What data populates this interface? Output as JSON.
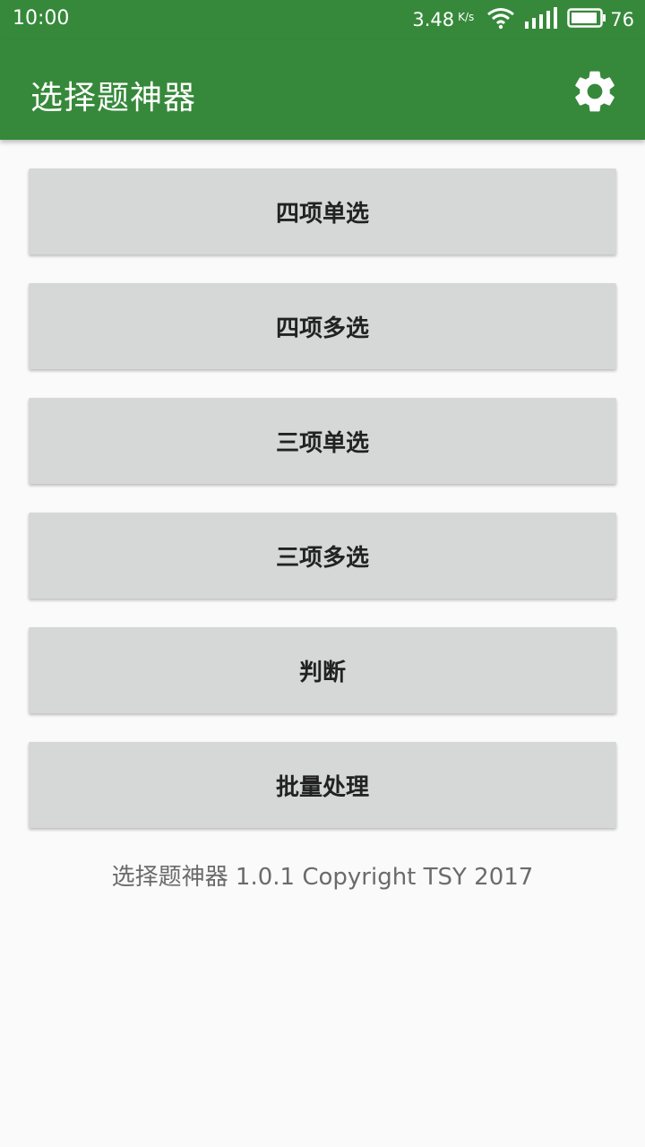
{
  "status_bar": {
    "time": "10:00",
    "net_speed": "3.48",
    "net_unit": "K/s",
    "battery_level": "76",
    "icons": [
      "wifi-icon",
      "signal-icon",
      "battery-icon"
    ]
  },
  "app_bar": {
    "title": "选择题神器",
    "settings_icon": "gear-icon",
    "color": "#36893a"
  },
  "menu": {
    "items": [
      {
        "label": "四项单选"
      },
      {
        "label": "四项多选"
      },
      {
        "label": "三项单选"
      },
      {
        "label": "三项多选"
      },
      {
        "label": "判断"
      },
      {
        "label": "批量处理"
      }
    ]
  },
  "footer": {
    "text": "选择题神器 1.0.1 Copyright TSY 2017"
  }
}
